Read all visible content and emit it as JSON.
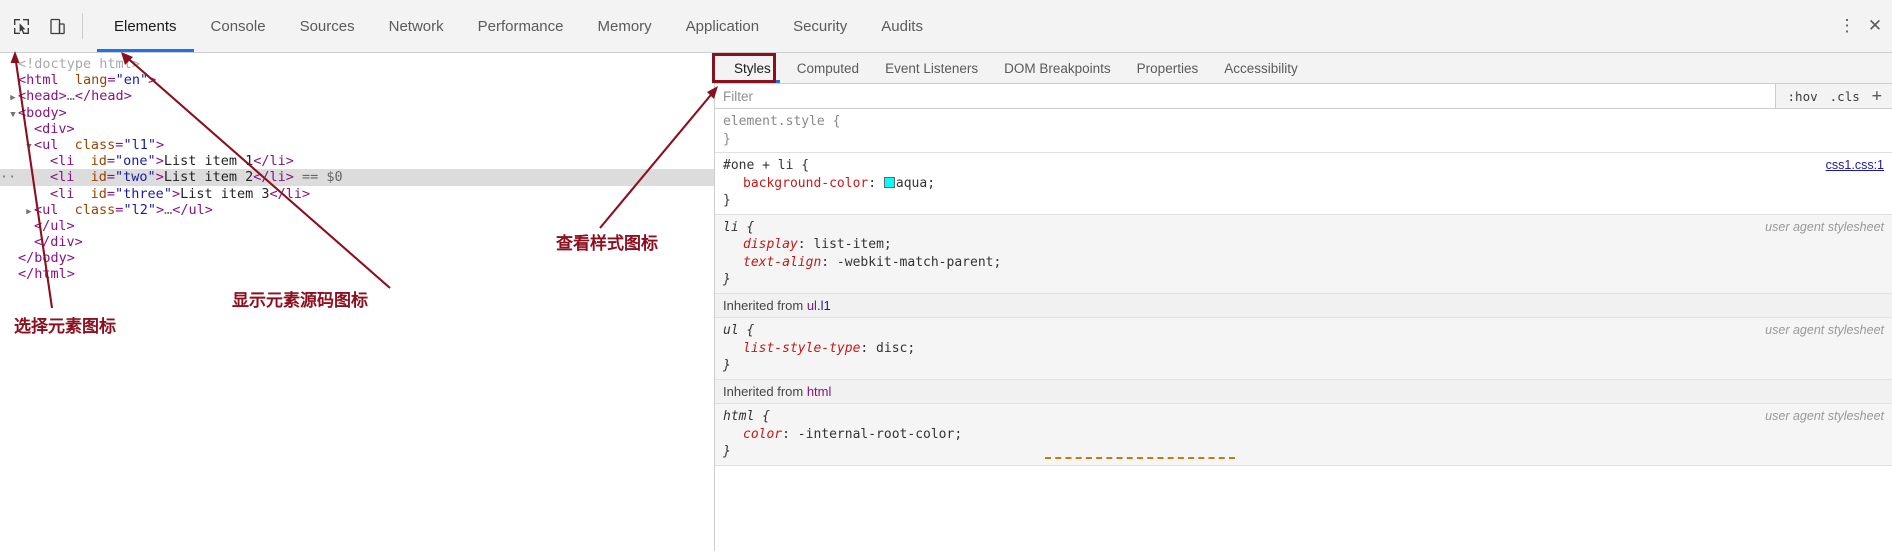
{
  "toolbar": {
    "icons": [
      {
        "name": "inspect-element-icon",
        "glyph": "cursor-arrow"
      },
      {
        "name": "device-toolbar-icon",
        "glyph": "device"
      }
    ],
    "tabs": [
      {
        "label": "Elements",
        "active": true
      },
      {
        "label": "Console",
        "active": false
      },
      {
        "label": "Sources",
        "active": false
      },
      {
        "label": "Network",
        "active": false
      },
      {
        "label": "Performance",
        "active": false
      },
      {
        "label": "Memory",
        "active": false
      },
      {
        "label": "Application",
        "active": false
      },
      {
        "label": "Security",
        "active": false
      },
      {
        "label": "Audits",
        "active": false
      }
    ],
    "more_label": "⋮",
    "close_label": "✕"
  },
  "dom_tree": {
    "lines": [
      {
        "indent": 0,
        "twisty": "",
        "text": "<!doctype html>",
        "kind": "doctype",
        "selected": false
      },
      {
        "indent": 0,
        "twisty": "",
        "text": "<html lang=\"en\">",
        "kind": "html-open",
        "selected": false
      },
      {
        "indent": 0,
        "twisty": "▶",
        "text": "<head>…</head>",
        "kind": "head",
        "selected": false
      },
      {
        "indent": 0,
        "twisty": "▼",
        "text": "<body>",
        "kind": "body",
        "selected": false
      },
      {
        "indent": 1,
        "twisty": "",
        "text": "<div>",
        "kind": "div",
        "selected": false
      },
      {
        "indent": 1,
        "twisty": "▼",
        "text": "<ul class=\"l1\">",
        "kind": "ul-l1",
        "selected": false
      },
      {
        "indent": 2,
        "twisty": "",
        "text": "<li id=\"one\">List item 1</li>",
        "kind": "li-one",
        "selected": false
      },
      {
        "indent": 2,
        "twisty": "",
        "text": "<li id=\"two\">List item 2</li> == $0",
        "kind": "li-two",
        "selected": true
      },
      {
        "indent": 2,
        "twisty": "",
        "text": "<li id=\"three\">List item 3</li>",
        "kind": "li-three",
        "selected": false
      },
      {
        "indent": 1,
        "twisty": "▶",
        "text": "<ul class=\"l2\">…</ul>",
        "kind": "ul-l2",
        "selected": false
      },
      {
        "indent": 1,
        "twisty": "",
        "text": "</ul>",
        "kind": "close-ul",
        "selected": false
      },
      {
        "indent": 1,
        "twisty": "",
        "text": "</div>",
        "kind": "close-div",
        "selected": false
      },
      {
        "indent": 0,
        "twisty": "",
        "text": "</body>",
        "kind": "close-body",
        "selected": false
      },
      {
        "indent": 0,
        "twisty": "",
        "text": "</html>",
        "kind": "close-html",
        "selected": false
      }
    ],
    "selected_marker": "··",
    "selected_suffix": "== $0"
  },
  "styles_panel": {
    "tabs": [
      {
        "label": "Styles",
        "active": true
      },
      {
        "label": "Computed",
        "active": false
      },
      {
        "label": "Event Listeners",
        "active": false
      },
      {
        "label": "DOM Breakpoints",
        "active": false
      },
      {
        "label": "Properties",
        "active": false
      },
      {
        "label": "Accessibility",
        "active": false
      }
    ],
    "filter": {
      "value": "",
      "placeholder": "Filter"
    },
    "tools": {
      "hov": ":hov",
      "cls": ".cls",
      "plus": "+"
    },
    "rules": [
      {
        "selector": "element.style {",
        "close": "}",
        "origin": "",
        "origin_is_link": false,
        "ua": false,
        "element_style": true,
        "declarations": []
      },
      {
        "selector": "#one + li {",
        "close": "}",
        "origin": "css1.css:1",
        "origin_is_link": true,
        "ua": false,
        "element_style": false,
        "declarations": [
          {
            "prop": "background-color",
            "value": "aqua",
            "swatch": "#00ffff"
          }
        ]
      },
      {
        "selector": "li {",
        "close": "}",
        "origin": "user agent stylesheet",
        "origin_is_link": false,
        "ua": true,
        "element_style": false,
        "declarations": [
          {
            "prop": "display",
            "value": "list-item",
            "swatch": ""
          },
          {
            "prop": "text-align",
            "value": "-webkit-match-parent",
            "swatch": ""
          }
        ]
      },
      {
        "inherited_from": "Inherited from",
        "inherited_target": "ul.l1"
      },
      {
        "selector": "ul {",
        "close": "}",
        "origin": "user agent stylesheet",
        "origin_is_link": false,
        "ua": true,
        "element_style": false,
        "declarations": [
          {
            "prop": "list-style-type",
            "value": "disc",
            "swatch": ""
          }
        ]
      },
      {
        "inherited_from": "Inherited from",
        "inherited_target": "html"
      },
      {
        "selector": "html {",
        "close": "}",
        "origin": "user agent stylesheet",
        "origin_is_link": false,
        "ua": true,
        "element_style": false,
        "declarations": [
          {
            "prop": "color",
            "value": "-internal-root-color",
            "swatch": ""
          }
        ]
      }
    ]
  },
  "annotations": [
    {
      "name": "select-element-icon-label",
      "text": "选择元素图标"
    },
    {
      "name": "show-element-source-icon-label",
      "text": "显示元素源码图标"
    },
    {
      "name": "view-styles-icon-label",
      "text": "查看样式图标"
    }
  ],
  "colors": {
    "accent": "#1a73e8",
    "annotation": "#8b0f1e",
    "aqua_swatch": "#00ffff",
    "selected_row": "#dcdcdc"
  }
}
